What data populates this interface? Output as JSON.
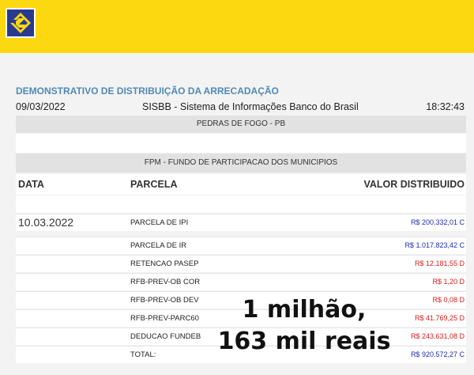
{
  "header": {
    "logo_icon": "banco-do-brasil-logo-icon",
    "brand_color": "#fcd810",
    "logo_color": "#2a3a8f"
  },
  "report": {
    "title": "DEMONSTRATIVO DE DISTRIBUIÇÃO DA ARRECADAÇÃO",
    "date": "09/03/2022",
    "system": "SISBB - Sistema de Informações Banco do Brasil",
    "time": "18:32:43",
    "city": "PEDRAS DE FOGO - PB",
    "fund": "FPM - FUNDO DE PARTICIPACAO DOS MUNICIPIOS"
  },
  "table": {
    "columns": [
      "DATA",
      "PARCELA",
      "VALOR DISTRIBUIDO"
    ],
    "rows": [
      {
        "data": "10.03.2022",
        "parcela": "PARCELA DE IPI",
        "valor": "R$ 200.332,01 C"
      },
      {
        "data": "",
        "parcela": "PARCELA DE IR",
        "valor": "R$ 1.017.823,42 C"
      },
      {
        "data": "",
        "parcela": "RETENCAO PASEP",
        "valor": "R$ 12.181,55 D"
      },
      {
        "data": "",
        "parcela": "RFB-PREV-OB COR",
        "valor": "R$ 1,20 D"
      },
      {
        "data": "",
        "parcela": "RFB-PREV-OB DEV",
        "valor": "R$ 0,08 D"
      },
      {
        "data": "",
        "parcela": "RFB-PREV-PARC60",
        "valor": "R$ 41.769,25 D"
      },
      {
        "data": "",
        "parcela": "DEDUCAO FUNDEB",
        "valor": "R$ 243.631,08 D"
      },
      {
        "data": "",
        "parcela": "TOTAL:",
        "valor": "R$ 920.572,27 C"
      }
    ]
  },
  "overlay": {
    "line1": "1 milhão,",
    "line2": "163 mil reais"
  }
}
